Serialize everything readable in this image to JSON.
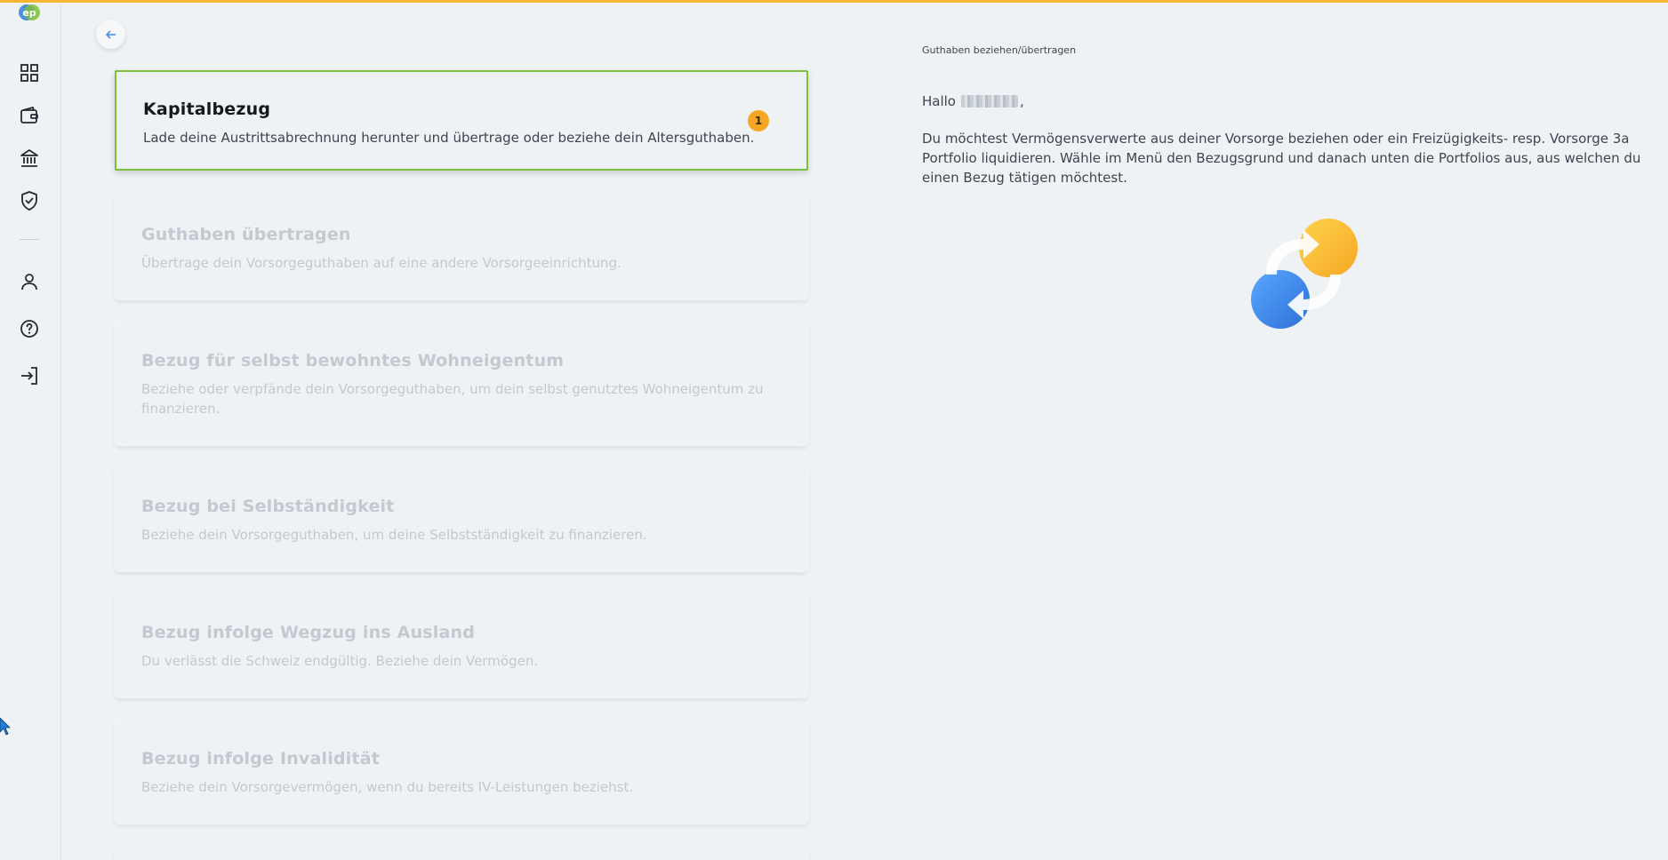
{
  "app": {
    "logo_text": "ep",
    "accent_color": "#f7b733",
    "active_color": "#7cbf3a",
    "badge_color": "#f5a623"
  },
  "sidebar": {
    "items": [
      {
        "name": "dashboard",
        "icon": "grid-icon"
      },
      {
        "name": "wallet",
        "icon": "wallet-icon"
      },
      {
        "name": "bank",
        "icon": "bank-icon"
      },
      {
        "name": "security",
        "icon": "shield-check-icon"
      },
      {
        "name": "profile",
        "icon": "user-icon"
      },
      {
        "name": "help",
        "icon": "help-circle-icon"
      },
      {
        "name": "login",
        "icon": "login-icon"
      }
    ]
  },
  "cards": [
    {
      "title": "Kapitalbezug",
      "desc": "Lade deine Austrittsabrechnung herunter und übertrage oder beziehe dein Altersguthaben.",
      "badge": "1",
      "state": "active"
    },
    {
      "title": "Guthaben übertragen",
      "desc": "Übertrage dein Vorsorgeguthaben auf eine andere Vorsorgeeinrichtung.",
      "state": "disabled"
    },
    {
      "title": "Bezug für selbst bewohntes Wohneigentum",
      "desc": "Beziehe oder verpfände dein Vorsorgeguthaben, um dein selbst genutztes Wohneigentum zu finanzieren.",
      "state": "disabled"
    },
    {
      "title": "Bezug bei Selbständigkeit",
      "desc": "Beziehe dein Vorsorgeguthaben, um deine Selbstständigkeit zu finanzieren.",
      "state": "disabled"
    },
    {
      "title": "Bezug infolge Wegzug ins Ausland",
      "desc": "Du verlässt die Schweiz endgültig. Beziehe dein Vermögen.",
      "state": "disabled"
    },
    {
      "title": "Bezug infolge Invalidität",
      "desc": "Beziehe dein Vorsorgevermögen, wenn du bereits IV-Leistungen beziehst.",
      "state": "disabled"
    }
  ],
  "right": {
    "section_label": "Guthaben beziehen/übertragen",
    "greeting_prefix": "Hallo",
    "greeting_suffix": ",",
    "intro": "Du möchtest Vermögensverwerte aus deiner Vorsorge beziehen oder ein Freizügigkeits- resp. Vorsorge 3a Portfolio liquidieren. Wähle im Menü den Bezugsgrund und danach unten die Portfolios aus, aus welchen du einen Bezug tätigen möchtest.",
    "illustration": "transfer-arrows-icon"
  }
}
